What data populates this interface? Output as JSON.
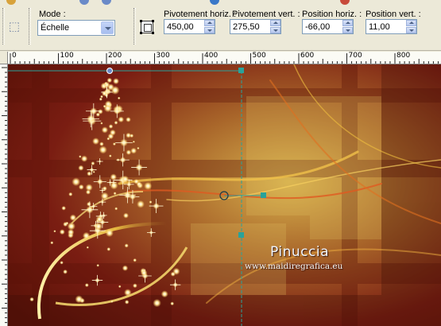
{
  "toolbar": {
    "mode_label": "Mode :",
    "mode_value": "Échelle",
    "pivot_h_label": "Pivotement horiz. :",
    "pivot_h_value": "450,00",
    "pivot_v_label": "Pivotement vert. :",
    "pivot_v_value": "275,50",
    "pos_h_label": "Position horiz. :",
    "pos_h_value": "-66,00",
    "pos_v_label": "Position vert. :",
    "pos_v_value": "11,00"
  },
  "ruler": {
    "h_ticks": [
      "0",
      "100",
      "200",
      "300",
      "400",
      "500",
      "600",
      "700",
      "800"
    ]
  },
  "watermark": {
    "name": "Pinuccia",
    "url": "www.maidiregrafica.eu"
  },
  "colors": {
    "toolbar_bg": "#ece9d8",
    "guide": "#2aa29a",
    "canvas_dark": "#7a1d12",
    "canvas_gold": "#c9a33a"
  }
}
